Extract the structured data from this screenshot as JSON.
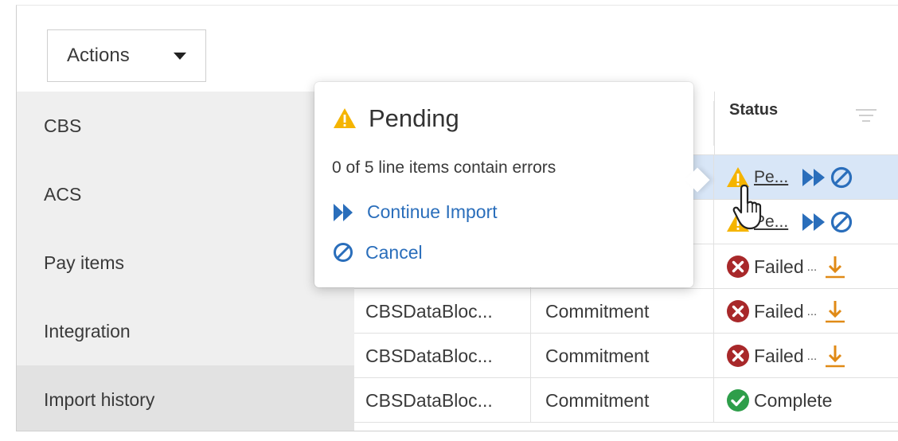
{
  "toolbar": {
    "actions_label": "Actions"
  },
  "sidebar": {
    "items": [
      {
        "label": "CBS"
      },
      {
        "label": "ACS"
      },
      {
        "label": "Pay items"
      },
      {
        "label": "Integration"
      },
      {
        "label": "Import history",
        "active": true
      }
    ]
  },
  "table": {
    "status_header": "Status",
    "rows": [
      {
        "name": "",
        "type": "",
        "status": "Pe...",
        "state": "pending",
        "highlight": true
      },
      {
        "name": "",
        "type": "",
        "status": "Pe...",
        "state": "pending"
      },
      {
        "name": "",
        "type": "",
        "status": "Failed",
        "state": "failed"
      },
      {
        "name": "CBSDataBloc...",
        "type": "Commitment",
        "status": "Failed",
        "state": "failed"
      },
      {
        "name": "CBSDataBloc...",
        "type": "Commitment",
        "status": "Failed",
        "state": "failed"
      },
      {
        "name": "CBSDataBloc...",
        "type": "Commitment",
        "status": "Complete",
        "state": "complete"
      }
    ]
  },
  "popover": {
    "title": "Pending",
    "message": "0 of 5 line items contain errors",
    "continue_label": "Continue Import",
    "cancel_label": "Cancel"
  },
  "colors": {
    "warning": "#f5b400",
    "failed": "#a8282a",
    "complete": "#2e9e4a",
    "link": "#2a6ebb",
    "download": "#e08a16"
  },
  "icons": [
    "caret-down-icon",
    "warning-icon",
    "fast-forward-icon",
    "cancel-icon",
    "failed-icon",
    "download-icon",
    "complete-icon",
    "filter-icon",
    "hand-cursor-icon"
  ]
}
